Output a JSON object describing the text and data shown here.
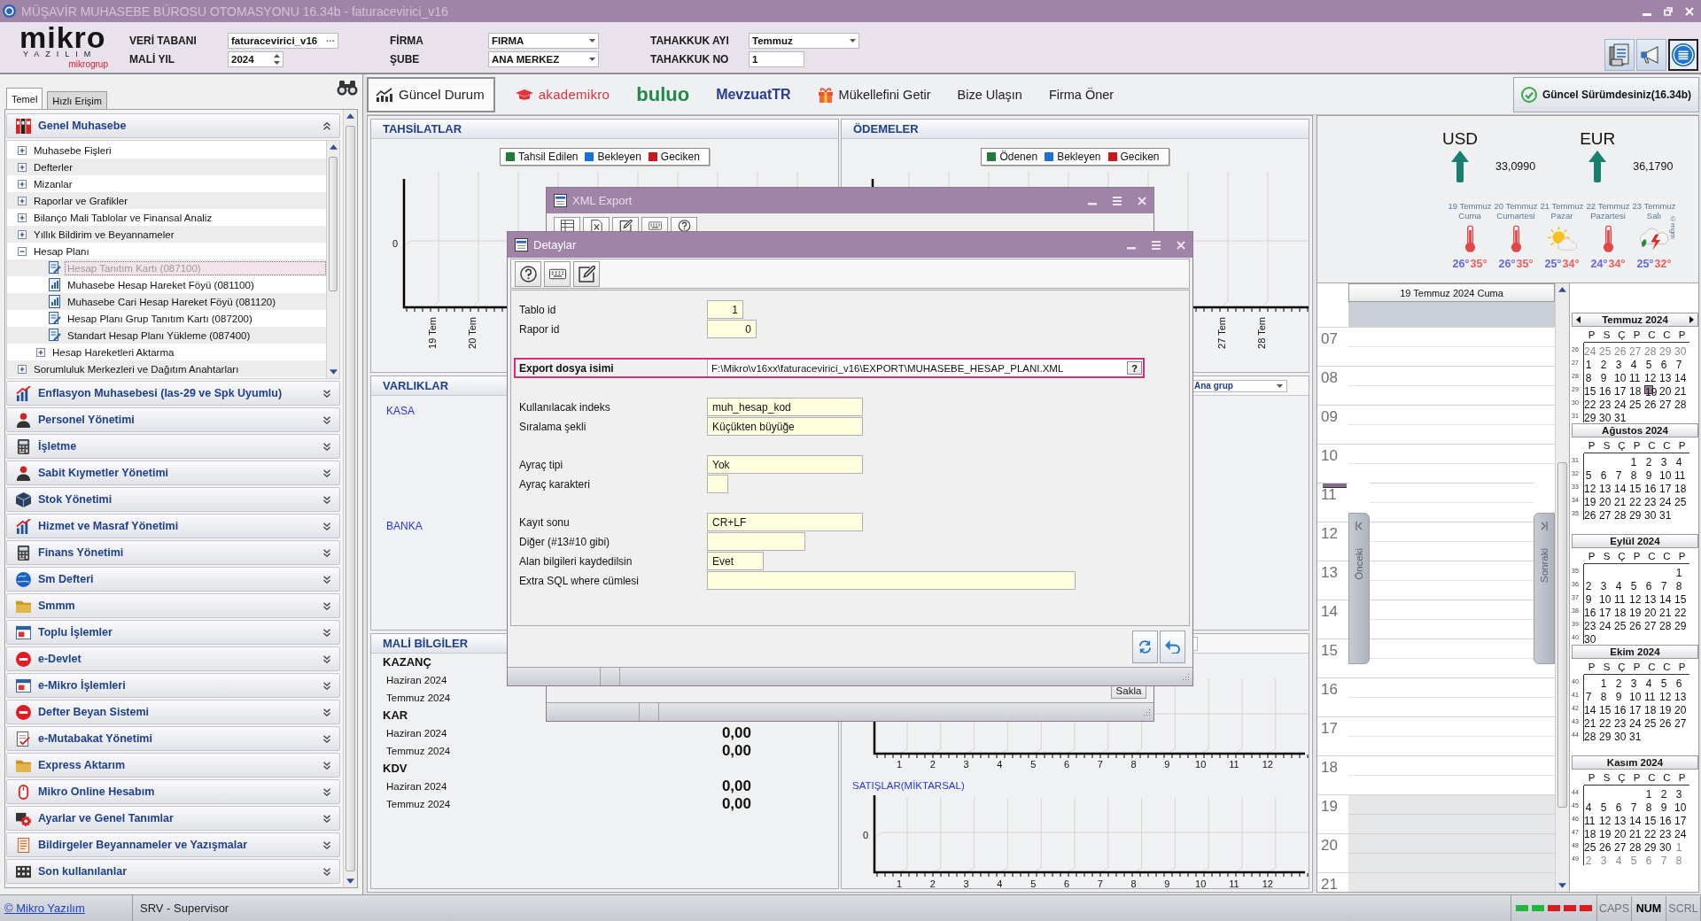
{
  "window": {
    "title": "MÜŞAVİR MUHASEBE BÜROSU OTOMASYONU 16.34b - faturacevirici_v16"
  },
  "header": {
    "logo": {
      "wordmark": "mikro",
      "subtitle": "YAZILIM",
      "group": "mikrogrup"
    },
    "columns": [
      [
        {
          "label": "VERİ TABANI",
          "value": "faturacevirici_v16",
          "kind": "browse",
          "button": "···"
        },
        {
          "label": "MALİ YIL",
          "value": "2024",
          "kind": "spinner"
        }
      ],
      [
        {
          "label": "FİRMA",
          "value": "FIRMA",
          "kind": "dropdown"
        },
        {
          "label": "ŞUBE",
          "value": "ANA MERKEZ",
          "kind": "dropdown"
        }
      ],
      [
        {
          "label": "TAHAKKUK AYI",
          "value": "Temmuz",
          "kind": "dropdown"
        },
        {
          "label": "TAHAKKUK NO",
          "value": "1",
          "kind": "text"
        }
      ]
    ]
  },
  "sidebar": {
    "tabs": [
      {
        "label": "Temel",
        "selected": true
      },
      {
        "label": "Hızlı Erişim",
        "selected": false
      }
    ],
    "sections": [
      {
        "title": "Genel Muhasebe",
        "expanded": true,
        "tree": [
          {
            "kind": "folder",
            "label": "Muhasebe Fişleri",
            "expanded": false,
            "selected": false
          },
          {
            "kind": "folder",
            "label": "Defterler",
            "expanded": false,
            "selected": false
          },
          {
            "kind": "folder",
            "label": "Mizanlar",
            "expanded": false,
            "selected": false
          },
          {
            "kind": "folder",
            "label": "Raporlar ve Grafikler",
            "expanded": false,
            "selected": false
          },
          {
            "kind": "folder",
            "label": "Bilanço Mali Tablolar ve Finansal Analiz",
            "expanded": false,
            "selected": false
          },
          {
            "kind": "folder",
            "label": "Yıllık Bildirim ve Beyannameler",
            "expanded": false,
            "selected": false
          },
          {
            "kind": "folder",
            "label": "Hesap Planı",
            "expanded": true,
            "selected": false,
            "children": [
              {
                "kind": "form",
                "label": "Hesap Tanıtım Kartı (087100)",
                "selected": true
              },
              {
                "kind": "report",
                "label": "Muhasebe Hesap Hareket Föyü (081100)",
                "selected": false
              },
              {
                "kind": "report",
                "label": "Muhasebe Cari Hesap Hareket Föyü (081120)",
                "selected": false
              },
              {
                "kind": "form",
                "label": "Hesap Planı Grup Tanıtım Kartı (087200)",
                "selected": false
              },
              {
                "kind": "form",
                "label": "Standart Hesap Planı Yükleme (087400)",
                "selected": false
              },
              {
                "kind": "folder",
                "label": "Hesap Hareketleri Aktarma",
                "expanded": false,
                "selected": false
              }
            ]
          },
          {
            "kind": "folder",
            "label": "Sorumluluk Merkezleri ve Dağıtım Anahtarları",
            "expanded": false,
            "selected": false
          }
        ]
      },
      {
        "title": "Enflasyon Muhasebesi (Ias-29 ve Spk Uyumlu)",
        "expanded": false
      },
      {
        "title": "Personel Yönetimi",
        "expanded": false
      },
      {
        "title": "İşletme",
        "expanded": false
      },
      {
        "title": "Sabit Kıymetler Yönetimi",
        "expanded": false
      },
      {
        "title": "Stok Yönetimi",
        "expanded": false
      },
      {
        "title": "Hizmet ve Masraf Yönetimi",
        "expanded": false
      },
      {
        "title": "Finans Yönetimi",
        "expanded": false
      },
      {
        "title": "Sm Defteri",
        "expanded": false
      },
      {
        "title": "Smmm",
        "expanded": false
      },
      {
        "title": "Toplu İşlemler",
        "expanded": false
      },
      {
        "title": "e-Devlet",
        "expanded": false
      },
      {
        "title": "e-Mikro İşlemleri",
        "expanded": false
      },
      {
        "title": "Defter Beyan Sistemi",
        "expanded": false
      },
      {
        "title": "e-Mutabakat Yönetimi",
        "expanded": false
      },
      {
        "title": "Express Aktarım",
        "expanded": false
      },
      {
        "title": "Mikro Online Hesabım",
        "expanded": false
      },
      {
        "title": "Ayarlar ve Genel Tanımlar",
        "expanded": false
      },
      {
        "title": "Bildirgeler Beyannameler ve Yazışmalar",
        "expanded": false
      },
      {
        "title": "Son kullanılanlar",
        "expanded": false
      }
    ]
  },
  "toolbar": {
    "items": [
      {
        "kind": "tab",
        "label": "Güncel Durum",
        "selected": true
      },
      {
        "kind": "academy",
        "label": "akademikro",
        "selected": false
      },
      {
        "kind": "brand",
        "label": "buluo",
        "selected": false
      },
      {
        "kind": "legal",
        "label": "MevzuatTR",
        "selected": false
      },
      {
        "kind": "gift",
        "label": "Mükellefini Getir",
        "selected": false
      },
      {
        "kind": "link",
        "label": "Bize Ulaşın",
        "selected": false
      },
      {
        "kind": "link",
        "label": "Firma Öner",
        "selected": false
      }
    ],
    "version": "Güncel Sürümdesiniz(16.34b)"
  },
  "dashboard": {
    "collections": {
      "title": "TAHSİLATLAR",
      "legend": [
        {
          "label": "Tahsil Edilen",
          "color": "#1e7b3a"
        },
        {
          "label": "Bekleyen",
          "color": "#1d6fd8"
        },
        {
          "label": "Geciken",
          "color": "#c8191e"
        }
      ],
      "y_labels": [
        "0"
      ],
      "x_labels": [
        "19 Tem",
        "20 Tem"
      ]
    },
    "payments": {
      "title": "ÖDEMELER",
      "legend": [
        {
          "label": "Ödenen",
          "color": "#1e7b3a"
        },
        {
          "label": "Bekleyen",
          "color": "#1d6fd8"
        },
        {
          "label": "Geciken",
          "color": "#c8191e"
        }
      ],
      "x_labels": [
        "27 Tem",
        "28 Tem"
      ]
    },
    "assets": {
      "title": "VARLIKLAR",
      "items": [
        "KASA",
        "BANKA"
      ]
    },
    "group_select": {
      "value": "Ana grup"
    },
    "financials": {
      "title": "MALİ BİLGİLER",
      "groups": [
        {
          "name": "KAZANÇ",
          "rows": [
            {
              "period": "Haziran 2024"
            },
            {
              "period": "Temmuz 2024"
            }
          ]
        },
        {
          "name": "KAR",
          "rows": [
            {
              "period": "Haziran 2024",
              "value": "0,00"
            },
            {
              "period": "Temmuz 2024",
              "value": "0,00"
            }
          ]
        },
        {
          "name": "KDV",
          "rows": [
            {
              "period": "Haziran 2024",
              "value": "0,00"
            },
            {
              "period": "Temmuz 2024",
              "value": "0,00"
            }
          ]
        }
      ]
    },
    "monthly_chart": {
      "x_labels": [
        "1",
        "2",
        "3",
        "4",
        "5",
        "6",
        "7",
        "8",
        "9",
        "10",
        "11",
        "12"
      ]
    },
    "sales_chart": {
      "title": "SATIŞLAR(MİKTARSAL)",
      "y_labels": [
        "0"
      ],
      "x_labels": [
        "1",
        "2",
        "3",
        "4",
        "5",
        "6",
        "7",
        "8",
        "9",
        "10",
        "11",
        "12"
      ]
    }
  },
  "rates": [
    {
      "code": "USD",
      "rate": "33,0990",
      "kind": "up"
    },
    {
      "code": "EUR",
      "rate": "36,1790",
      "kind": "up"
    }
  ],
  "weather": {
    "days": [
      {
        "date": "19 Temmuz",
        "day": "Cuma",
        "kind": "hot",
        "low": "26°",
        "high": "35°"
      },
      {
        "date": "20 Temmuz",
        "day": "Cumartesi",
        "kind": "hot",
        "low": "26°",
        "high": "35°"
      },
      {
        "date": "21 Temmuz",
        "day": "Pazar",
        "kind": "sunny",
        "low": "25°",
        "high": "34°"
      },
      {
        "date": "22 Temmuz",
        "day": "Pazartesi",
        "kind": "hot",
        "low": "24°",
        "high": "34°"
      },
      {
        "date": "23 Temmuz",
        "day": "Salı",
        "kind": "storm",
        "low": "25°",
        "high": "32°"
      }
    ],
    "credit": "©mgm"
  },
  "day_view": {
    "title": "19 Temmuz 2024 Cuma",
    "hours": [
      {
        "label": "07",
        "working": true,
        "current": false
      },
      {
        "label": "08",
        "working": true,
        "current": false
      },
      {
        "label": "09",
        "working": true,
        "current": false
      },
      {
        "label": "10",
        "working": true,
        "current": false
      },
      {
        "label": "11",
        "working": true,
        "current": true
      },
      {
        "label": "12",
        "working": true,
        "current": false
      },
      {
        "label": "13",
        "working": true,
        "current": false
      },
      {
        "label": "14",
        "working": true,
        "current": false
      },
      {
        "label": "15",
        "working": true,
        "current": false
      },
      {
        "label": "16",
        "working": true,
        "current": false
      },
      {
        "label": "17",
        "working": true,
        "current": false
      },
      {
        "label": "18",
        "working": true,
        "current": false
      },
      {
        "label": "19",
        "working": false,
        "current": false
      },
      {
        "label": "20",
        "working": false,
        "current": false
      },
      {
        "label": "21",
        "working": false,
        "current": false
      }
    ],
    "previous": "Önceki",
    "next": "Sonraki"
  },
  "calendar": {
    "months": [
      {
        "title": "Temmuz 2024",
        "navigation": true,
        "weekdays": [
          "P",
          "S",
          "Ç",
          "P",
          "C",
          "C",
          "P"
        ],
        "weeks": [
          {
            "number": "26",
            "days": [
              {
                "label": "24",
                "muted": true,
                "selected": false
              },
              {
                "label": "25",
                "muted": true,
                "selected": false
              },
              {
                "label": "26",
                "muted": true,
                "selected": false
              },
              {
                "label": "27",
                "muted": true,
                "selected": false
              },
              {
                "label": "28",
                "muted": true,
                "selected": false
              },
              {
                "label": "29",
                "muted": true,
                "selected": false
              },
              {
                "label": "30",
                "muted": true,
                "selected": false
              }
            ]
          },
          {
            "number": "27",
            "days": [
              {
                "label": "1",
                "muted": false,
                "selected": false
              },
              {
                "label": "2",
                "muted": false,
                "selected": false
              },
              {
                "label": "3",
                "muted": false,
                "selected": false
              },
              {
                "label": "4",
                "muted": false,
                "selected": false
              },
              {
                "label": "5",
                "muted": false,
                "selected": false
              },
              {
                "label": "6",
                "muted": false,
                "selected": false
              },
              {
                "label": "7",
                "muted": false,
                "selected": false
              }
            ]
          },
          {
            "number": "28",
            "days": [
              {
                "label": "8",
                "muted": false,
                "selected": false
              },
              {
                "label": "9",
                "muted": false,
                "selected": false
              },
              {
                "label": "10",
                "muted": false,
                "selected": false
              },
              {
                "label": "11",
                "muted": false,
                "selected": false
              },
              {
                "label": "12",
                "muted": false,
                "selected": false
              },
              {
                "label": "13",
                "muted": false,
                "selected": false
              },
              {
                "label": "14",
                "muted": false,
                "selected": false
              }
            ]
          },
          {
            "number": "29",
            "days": [
              {
                "label": "15",
                "muted": false,
                "selected": false
              },
              {
                "label": "16",
                "muted": false,
                "selected": false
              },
              {
                "label": "17",
                "muted": false,
                "selected": false
              },
              {
                "label": "18",
                "muted": false,
                "selected": false
              },
              {
                "label": "19",
                "muted": false,
                "selected": true
              },
              {
                "label": "20",
                "muted": false,
                "selected": false
              },
              {
                "label": "21",
                "muted": false,
                "selected": false
              }
            ]
          },
          {
            "number": "30",
            "days": [
              {
                "label": "22",
                "muted": false,
                "selected": false
              },
              {
                "label": "23",
                "muted": false,
                "selected": false
              },
              {
                "label": "24",
                "muted": false,
                "selected": false
              },
              {
                "label": "25",
                "muted": false,
                "selected": false
              },
              {
                "label": "26",
                "muted": false,
                "selected": false
              },
              {
                "label": "27",
                "muted": false,
                "selected": false
              },
              {
                "label": "28",
                "muted": false,
                "selected": false
              }
            ]
          },
          {
            "number": "31",
            "days": [
              {
                "label": "29",
                "muted": false,
                "selected": false
              },
              {
                "label": "30",
                "muted": false,
                "selected": false
              },
              {
                "label": "31",
                "muted": false,
                "selected": false
              }
            ]
          }
        ]
      },
      {
        "title": "Ağustos 2024",
        "navigation": false,
        "weekdays": [
          "P",
          "S",
          "Ç",
          "P",
          "C",
          "C",
          "P"
        ],
        "weeks": [
          {
            "number": "31",
            "days": [
              {
                "label": "1",
                "muted": false,
                "selected": false
              },
              {
                "label": "2",
                "muted": false,
                "selected": false
              },
              {
                "label": "3",
                "muted": false,
                "selected": false
              },
              {
                "label": "4",
                "muted": false,
                "selected": false
              }
            ]
          },
          {
            "number": "32",
            "days": [
              {
                "label": "5",
                "muted": false,
                "selected": false
              },
              {
                "label": "6",
                "muted": false,
                "selected": false
              },
              {
                "label": "7",
                "muted": false,
                "selected": false
              },
              {
                "label": "8",
                "muted": false,
                "selected": false
              },
              {
                "label": "9",
                "muted": false,
                "selected": false
              },
              {
                "label": "10",
                "muted": false,
                "selected": false
              },
              {
                "label": "11",
                "muted": false,
                "selected": false
              }
            ]
          },
          {
            "number": "33",
            "days": [
              {
                "label": "12",
                "muted": false,
                "selected": false
              },
              {
                "label": "13",
                "muted": false,
                "selected": false
              },
              {
                "label": "14",
                "muted": false,
                "selected": false
              },
              {
                "label": "15",
                "muted": false,
                "selected": false
              },
              {
                "label": "16",
                "muted": false,
                "selected": false
              },
              {
                "label": "17",
                "muted": false,
                "selected": false
              },
              {
                "label": "18",
                "muted": false,
                "selected": false
              }
            ]
          },
          {
            "number": "34",
            "days": [
              {
                "label": "19",
                "muted": false,
                "selected": false
              },
              {
                "label": "20",
                "muted": false,
                "selected": false
              },
              {
                "label": "21",
                "muted": false,
                "selected": false
              },
              {
                "label": "22",
                "muted": false,
                "selected": false
              },
              {
                "label": "23",
                "muted": false,
                "selected": false
              },
              {
                "label": "24",
                "muted": false,
                "selected": false
              },
              {
                "label": "25",
                "muted": false,
                "selected": false
              }
            ]
          },
          {
            "number": "35",
            "days": [
              {
                "label": "26",
                "muted": false,
                "selected": false
              },
              {
                "label": "27",
                "muted": false,
                "selected": false
              },
              {
                "label": "28",
                "muted": false,
                "selected": false
              },
              {
                "label": "29",
                "muted": false,
                "selected": false
              },
              {
                "label": "30",
                "muted": false,
                "selected": false
              },
              {
                "label": "31",
                "muted": false,
                "selected": false
              }
            ]
          }
        ]
      },
      {
        "title": "Eylül 2024",
        "navigation": false,
        "weekdays": [
          "P",
          "S",
          "Ç",
          "P",
          "C",
          "C",
          "P"
        ],
        "weeks": [
          {
            "number": "35",
            "days": [
              {
                "label": "1",
                "muted": false,
                "selected": false
              }
            ]
          },
          {
            "number": "36",
            "days": [
              {
                "label": "2",
                "muted": false,
                "selected": false
              },
              {
                "label": "3",
                "muted": false,
                "selected": false
              },
              {
                "label": "4",
                "muted": false,
                "selected": false
              },
              {
                "label": "5",
                "muted": false,
                "selected": false
              },
              {
                "label": "6",
                "muted": false,
                "selected": false
              },
              {
                "label": "7",
                "muted": false,
                "selected": false
              },
              {
                "label": "8",
                "muted": false,
                "selected": false
              }
            ]
          },
          {
            "number": "37",
            "days": [
              {
                "label": "9",
                "muted": false,
                "selected": false
              },
              {
                "label": "10",
                "muted": false,
                "selected": false
              },
              {
                "label": "11",
                "muted": false,
                "selected": false
              },
              {
                "label": "12",
                "muted": false,
                "selected": false
              },
              {
                "label": "13",
                "muted": false,
                "selected": false
              },
              {
                "label": "14",
                "muted": false,
                "selected": false
              },
              {
                "label": "15",
                "muted": false,
                "selected": false
              }
            ]
          },
          {
            "number": "38",
            "days": [
              {
                "label": "16",
                "muted": false,
                "selected": false
              },
              {
                "label": "17",
                "muted": false,
                "selected": false
              },
              {
                "label": "18",
                "muted": false,
                "selected": false
              },
              {
                "label": "19",
                "muted": false,
                "selected": false
              },
              {
                "label": "20",
                "muted": false,
                "selected": false
              },
              {
                "label": "21",
                "muted": false,
                "selected": false
              },
              {
                "label": "22",
                "muted": false,
                "selected": false
              }
            ]
          },
          {
            "number": "39",
            "days": [
              {
                "label": "23",
                "muted": false,
                "selected": false
              },
              {
                "label": "24",
                "muted": false,
                "selected": false
              },
              {
                "label": "25",
                "muted": false,
                "selected": false
              },
              {
                "label": "26",
                "muted": false,
                "selected": false
              },
              {
                "label": "27",
                "muted": false,
                "selected": false
              },
              {
                "label": "28",
                "muted": false,
                "selected": false
              },
              {
                "label": "29",
                "muted": false,
                "selected": false
              }
            ]
          },
          {
            "number": "40",
            "days": [
              {
                "label": "30",
                "muted": false,
                "selected": false
              }
            ]
          }
        ]
      },
      {
        "title": "Ekim 2024",
        "navigation": false,
        "weekdays": [
          "P",
          "S",
          "Ç",
          "P",
          "C",
          "C",
          "P"
        ],
        "weeks": [
          {
            "number": "40",
            "days": [
              {
                "label": "1",
                "muted": false,
                "selected": false
              },
              {
                "label": "2",
                "muted": false,
                "selected": false
              },
              {
                "label": "3",
                "muted": false,
                "selected": false
              },
              {
                "label": "4",
                "muted": false,
                "selected": false
              },
              {
                "label": "5",
                "muted": false,
                "selected": false
              },
              {
                "label": "6",
                "muted": false,
                "selected": false
              }
            ]
          },
          {
            "number": "41",
            "days": [
              {
                "label": "7",
                "muted": false,
                "selected": false
              },
              {
                "label": "8",
                "muted": false,
                "selected": false
              },
              {
                "label": "9",
                "muted": false,
                "selected": false
              },
              {
                "label": "10",
                "muted": false,
                "selected": false
              },
              {
                "label": "11",
                "muted": false,
                "selected": false
              },
              {
                "label": "12",
                "muted": false,
                "selected": false
              },
              {
                "label": "13",
                "muted": false,
                "selected": false
              }
            ]
          },
          {
            "number": "42",
            "days": [
              {
                "label": "14",
                "muted": false,
                "selected": false
              },
              {
                "label": "15",
                "muted": false,
                "selected": false
              },
              {
                "label": "16",
                "muted": false,
                "selected": false
              },
              {
                "label": "17",
                "muted": false,
                "selected": false
              },
              {
                "label": "18",
                "muted": false,
                "selected": false
              },
              {
                "label": "19",
                "muted": false,
                "selected": false
              },
              {
                "label": "20",
                "muted": false,
                "selected": false
              }
            ]
          },
          {
            "number": "43",
            "days": [
              {
                "label": "21",
                "muted": false,
                "selected": false
              },
              {
                "label": "22",
                "muted": false,
                "selected": false
              },
              {
                "label": "23",
                "muted": false,
                "selected": false
              },
              {
                "label": "24",
                "muted": false,
                "selected": false
              },
              {
                "label": "25",
                "muted": false,
                "selected": false
              },
              {
                "label": "26",
                "muted": false,
                "selected": false
              },
              {
                "label": "27",
                "muted": false,
                "selected": false
              }
            ]
          },
          {
            "number": "44",
            "days": [
              {
                "label": "28",
                "muted": false,
                "selected": false
              },
              {
                "label": "29",
                "muted": false,
                "selected": false
              },
              {
                "label": "30",
                "muted": false,
                "selected": false
              },
              {
                "label": "31",
                "muted": false,
                "selected": false
              }
            ]
          }
        ]
      },
      {
        "title": "Kasım 2024",
        "navigation": false,
        "weekdays": [
          "P",
          "S",
          "Ç",
          "P",
          "C",
          "C",
          "P"
        ],
        "weeks": [
          {
            "number": "44",
            "days": [
              {
                "label": "1",
                "muted": false,
                "selected": false
              },
              {
                "label": "2",
                "muted": false,
                "selected": false
              },
              {
                "label": "3",
                "muted": false,
                "selected": false
              }
            ]
          },
          {
            "number": "45",
            "days": [
              {
                "label": "4",
                "muted": false,
                "selected": false
              },
              {
                "label": "5",
                "muted": false,
                "selected": false
              },
              {
                "label": "6",
                "muted": false,
                "selected": false
              },
              {
                "label": "7",
                "muted": false,
                "selected": false
              },
              {
                "label": "8",
                "muted": false,
                "selected": false
              },
              {
                "label": "9",
                "muted": false,
                "selected": false
              },
              {
                "label": "10",
                "muted": false,
                "selected": false
              }
            ]
          },
          {
            "number": "46",
            "days": [
              {
                "label": "11",
                "muted": false,
                "selected": false
              },
              {
                "label": "12",
                "muted": false,
                "selected": false
              },
              {
                "label": "13",
                "muted": false,
                "selected": false
              },
              {
                "label": "14",
                "muted": false,
                "selected": false
              },
              {
                "label": "15",
                "muted": false,
                "selected": false
              },
              {
                "label": "16",
                "muted": false,
                "selected": false
              },
              {
                "label": "17",
                "muted": false,
                "selected": false
              }
            ]
          },
          {
            "number": "47",
            "days": [
              {
                "label": "18",
                "muted": false,
                "selected": false
              },
              {
                "label": "19",
                "muted": false,
                "selected": false
              },
              {
                "label": "20",
                "muted": false,
                "selected": false
              },
              {
                "label": "21",
                "muted": false,
                "selected": false
              },
              {
                "label": "22",
                "muted": false,
                "selected": false
              },
              {
                "label": "23",
                "muted": false,
                "selected": false
              },
              {
                "label": "24",
                "muted": false,
                "selected": false
              }
            ]
          },
          {
            "number": "48",
            "days": [
              {
                "label": "25",
                "muted": false,
                "selected": false
              },
              {
                "label": "26",
                "muted": false,
                "selected": false
              },
              {
                "label": "27",
                "muted": false,
                "selected": false
              },
              {
                "label": "28",
                "muted": false,
                "selected": false
              },
              {
                "label": "29",
                "muted": false,
                "selected": false
              },
              {
                "label": "30",
                "muted": false,
                "selected": false
              },
              {
                "label": "1",
                "muted": true,
                "selected": false
              }
            ]
          },
          {
            "number": "49",
            "days": [
              {
                "label": "2",
                "muted": true,
                "selected": false
              },
              {
                "label": "3",
                "muted": true,
                "selected": false
              },
              {
                "label": "4",
                "muted": true,
                "selected": false
              },
              {
                "label": "5",
                "muted": true,
                "selected": false
              },
              {
                "label": "6",
                "muted": true,
                "selected": false
              },
              {
                "label": "7",
                "muted": true,
                "selected": false
              },
              {
                "label": "8",
                "muted": true,
                "selected": false
              }
            ]
          }
        ]
      }
    ]
  },
  "dialogs": {
    "xml_export": {
      "title": "XML Export",
      "save": "Sakla"
    },
    "details": {
      "title": "Detaylar",
      "groups": [
        [
          {
            "label": "Tablo id",
            "value": "1",
            "kind": "number",
            "selected": false
          },
          {
            "label": "Rapor id",
            "value": "0",
            "kind": "number",
            "selected": false
          }
        ],
        [
          {
            "label": "Export dosya isimi",
            "value": "F:\\Mikro\\v16xx\\faturacevirici_v16\\EXPORT\\MUHASEBE_HESAP_PLANI.XML",
            "kind": "file",
            "button": "?",
            "selected": true
          }
        ],
        [
          {
            "label": "Kullanılacak indeks",
            "value": "muh_hesap_kod",
            "kind": "text",
            "selected": false
          },
          {
            "label": "Sıralama şekli",
            "value": "Küçükten büyüğe",
            "kind": "text",
            "selected": false
          }
        ],
        [
          {
            "label": "Ayraç tipi",
            "value": "Yok",
            "kind": "text",
            "selected": false
          },
          {
            "label": "Ayraç karakteri",
            "kind": "text",
            "selected": false
          }
        ],
        [
          {
            "label": "Kayıt sonu",
            "value": "CR+LF",
            "kind": "text",
            "selected": false
          },
          {
            "label": "Diğer (#13#10 gibi)",
            "kind": "text",
            "selected": false
          },
          {
            "label": "Alan bilgileri kaydedilsin",
            "value": "Evet",
            "kind": "text",
            "selected": false
          },
          {
            "label": "Extra SQL where cümlesi",
            "kind": "text",
            "selected": false
          }
        ]
      ]
    }
  },
  "status_bar": {
    "link": "© Mikro Yazılım",
    "user": "SRV - Supervisor",
    "leds": [
      {
        "color": "#1fb83a"
      },
      {
        "color": "#1fb83a"
      },
      {
        "color": "#d81c22"
      },
      {
        "color": "#d81c22"
      },
      {
        "color": "#d81c22"
      }
    ],
    "keys": [
      {
        "label": "CAPS",
        "on": false
      },
      {
        "label": "NUM",
        "on": true
      },
      {
        "label": "SCRL",
        "on": false
      }
    ]
  }
}
